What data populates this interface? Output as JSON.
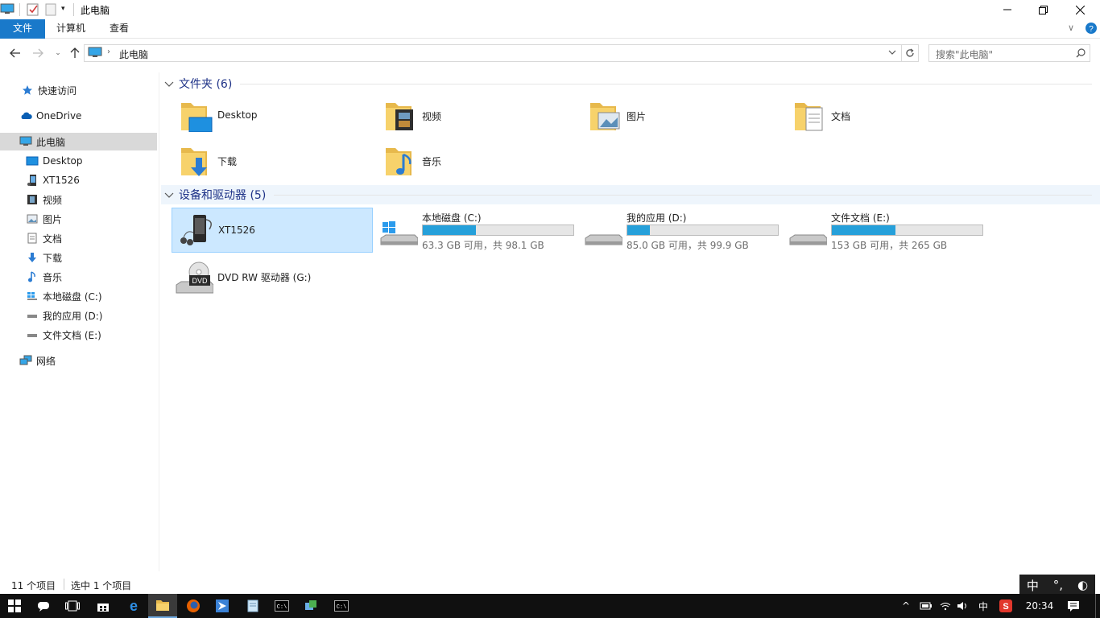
{
  "window": {
    "title": "此电脑"
  },
  "ribbon": {
    "tabs": [
      "文件",
      "计算机",
      "查看"
    ]
  },
  "address": {
    "crumb": "此电脑",
    "search_placeholder": "搜索\"此电脑\""
  },
  "nav": {
    "quick_access": "快速访问",
    "onedrive": "OneDrive",
    "this_pc": "此电脑",
    "children": [
      "Desktop",
      "XT1526",
      "视频",
      "图片",
      "文档",
      "下载",
      "音乐",
      "本地磁盘 (C:)",
      "我的应用 (D:)",
      "文件文档 (E:)"
    ],
    "network": "网络"
  },
  "folders": {
    "header": "文件夹 (6)",
    "items": [
      "Desktop",
      "视频",
      "图片",
      "文档",
      "下载",
      "音乐"
    ]
  },
  "devices": {
    "header": "设备和驱动器 (5)",
    "phone": "XT1526",
    "drives": [
      {
        "name": "本地磁盘 (C:)",
        "info": "63.3 GB 可用，共 98.1 GB",
        "used_fraction": 0.355
      },
      {
        "name": "我的应用 (D:)",
        "info": "85.0 GB 可用，共 99.9 GB",
        "used_fraction": 0.149
      },
      {
        "name": "文件文档 (E:)",
        "info": "153 GB 可用，共 265 GB",
        "used_fraction": 0.423
      }
    ],
    "dvd": "DVD RW 驱动器 (G:)",
    "dvd_badge": "DVD"
  },
  "status": {
    "count": "11 个项目",
    "selected": "选中 1 个项目"
  },
  "ime": {
    "mode": "中",
    "punct": "°,"
  },
  "taskbar": {
    "ime_lang": "中",
    "time": "20:34"
  },
  "colors": {
    "accent": "#1979ca",
    "bar_fill": "#26a0da",
    "selection": "#cce8ff",
    "group_header": "#1e3287"
  }
}
